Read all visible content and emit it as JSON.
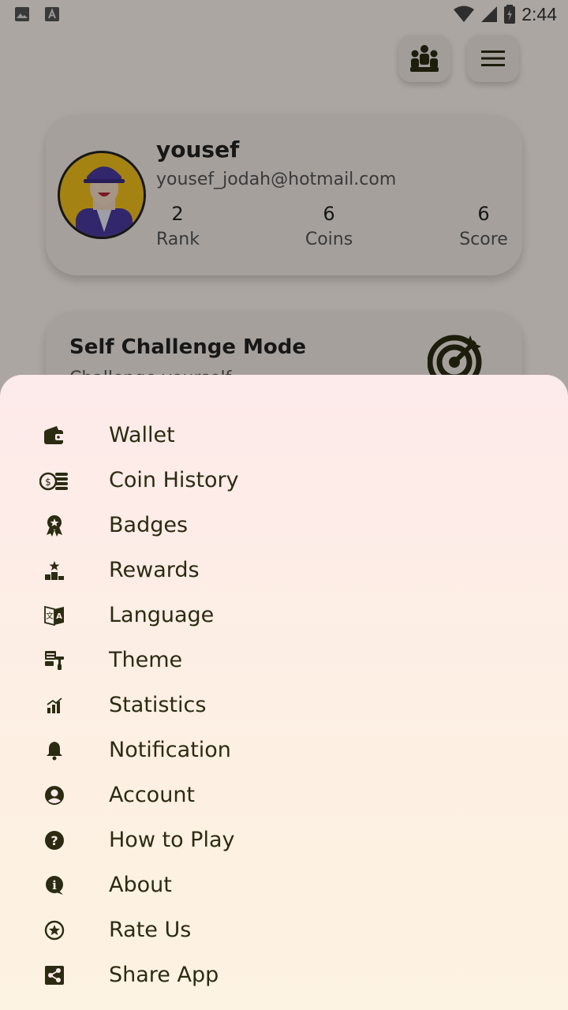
{
  "status_bar": {
    "time": "2:44"
  },
  "profile": {
    "name": "yousef",
    "email": "yousef_jodah@hotmail.com",
    "stats": [
      {
        "value": "2",
        "label": "Rank"
      },
      {
        "value": "6",
        "label": "Coins"
      },
      {
        "value": "6",
        "label": "Score"
      }
    ]
  },
  "mode_card": {
    "title": "Self Challenge Mode",
    "subtitle": "Challenge yourself"
  },
  "menu": {
    "items": [
      {
        "label": "Wallet",
        "icon": "wallet-icon"
      },
      {
        "label": "Coin History",
        "icon": "coins-icon"
      },
      {
        "label": "Badges",
        "icon": "badge-icon"
      },
      {
        "label": "Rewards",
        "icon": "podium-icon"
      },
      {
        "label": "Language",
        "icon": "translate-icon"
      },
      {
        "label": "Theme",
        "icon": "theme-icon"
      },
      {
        "label": "Statistics",
        "icon": "chart-icon"
      },
      {
        "label": "Notification",
        "icon": "bell-icon"
      },
      {
        "label": "Account",
        "icon": "account-icon"
      },
      {
        "label": "How to Play",
        "icon": "help-icon"
      },
      {
        "label": "About",
        "icon": "info-icon"
      },
      {
        "label": "Rate Us",
        "icon": "star-icon"
      },
      {
        "label": "Share App",
        "icon": "share-icon"
      }
    ]
  },
  "colors": {
    "sheet_top": "#fdeaea",
    "sheet_bottom": "#fdf3e2",
    "text_dark": "#2b2b12",
    "avatar_bg": "#f3c21d"
  }
}
